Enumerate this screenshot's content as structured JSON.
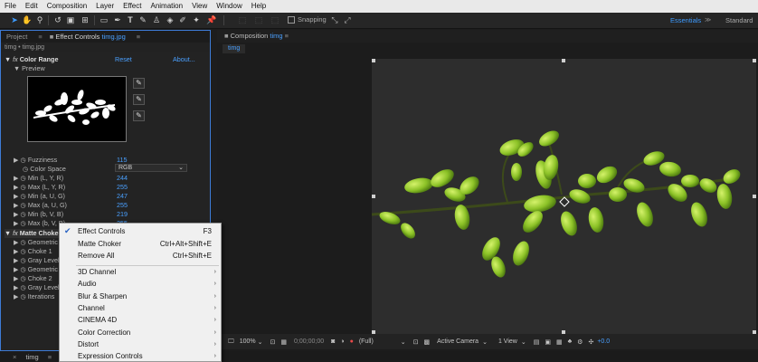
{
  "menubar": [
    "File",
    "Edit",
    "Composition",
    "Layer",
    "Effect",
    "Animation",
    "View",
    "Window",
    "Help"
  ],
  "toolbar": {
    "snapping_label": "Snapping",
    "workspace_active": "Essentials",
    "workspace_other": "Standard"
  },
  "left_panel": {
    "tabs": [
      {
        "label": "Project"
      },
      {
        "label": "Effect Controls",
        "target": "timg.jpg"
      }
    ],
    "breadcrumb": "timg • timg.jpg",
    "effect_name": "Color Range",
    "reset_label": "Reset",
    "about_label": "About...",
    "preview_label": "Preview",
    "properties": [
      {
        "name": "Fuzziness",
        "value": "115"
      },
      {
        "name": "Color Space",
        "value": "RGB"
      },
      {
        "name": "Min (L, Y, R)",
        "value": "244"
      },
      {
        "name": "Max (L, Y, R)",
        "value": "255"
      },
      {
        "name": "Min (a, U, G)",
        "value": "247"
      },
      {
        "name": "Max (a, U, G)",
        "value": "255"
      },
      {
        "name": "Min (b, V, B)",
        "value": "219"
      },
      {
        "name": "Max (b, V, B)",
        "value": "255"
      }
    ],
    "matte_choker": "Matte Choker",
    "matte_props": [
      "Geometric Softness 1",
      "Choke 1",
      "Gray Level Softness 1",
      "Geometric Softness 2",
      "Choke 2",
      "Gray Level Softness 2",
      "Iterations"
    ]
  },
  "comp_panel": {
    "tab_label": "Composition",
    "tab_target": "timg",
    "sub_tab": "timg",
    "zoom": "100%",
    "timecode": "0;00;00;00",
    "resolution": "(Full)",
    "camera": "Active Camera",
    "views": "1 View",
    "exposure": "+0.0"
  },
  "bottom_tab": "timg",
  "context_menu": {
    "items": [
      {
        "label": "Effect Controls",
        "shortcut": "F3",
        "checked": true
      },
      {
        "label": "Matte Choker",
        "shortcut": "Ctrl+Alt+Shift+E"
      },
      {
        "label": "Remove All",
        "shortcut": "Ctrl+Shift+E"
      }
    ],
    "submenus": [
      "3D Channel",
      "Audio",
      "Blur & Sharpen",
      "Channel",
      "CINEMA 4D",
      "Color Correction",
      "Distort",
      "Expression Controls"
    ]
  }
}
